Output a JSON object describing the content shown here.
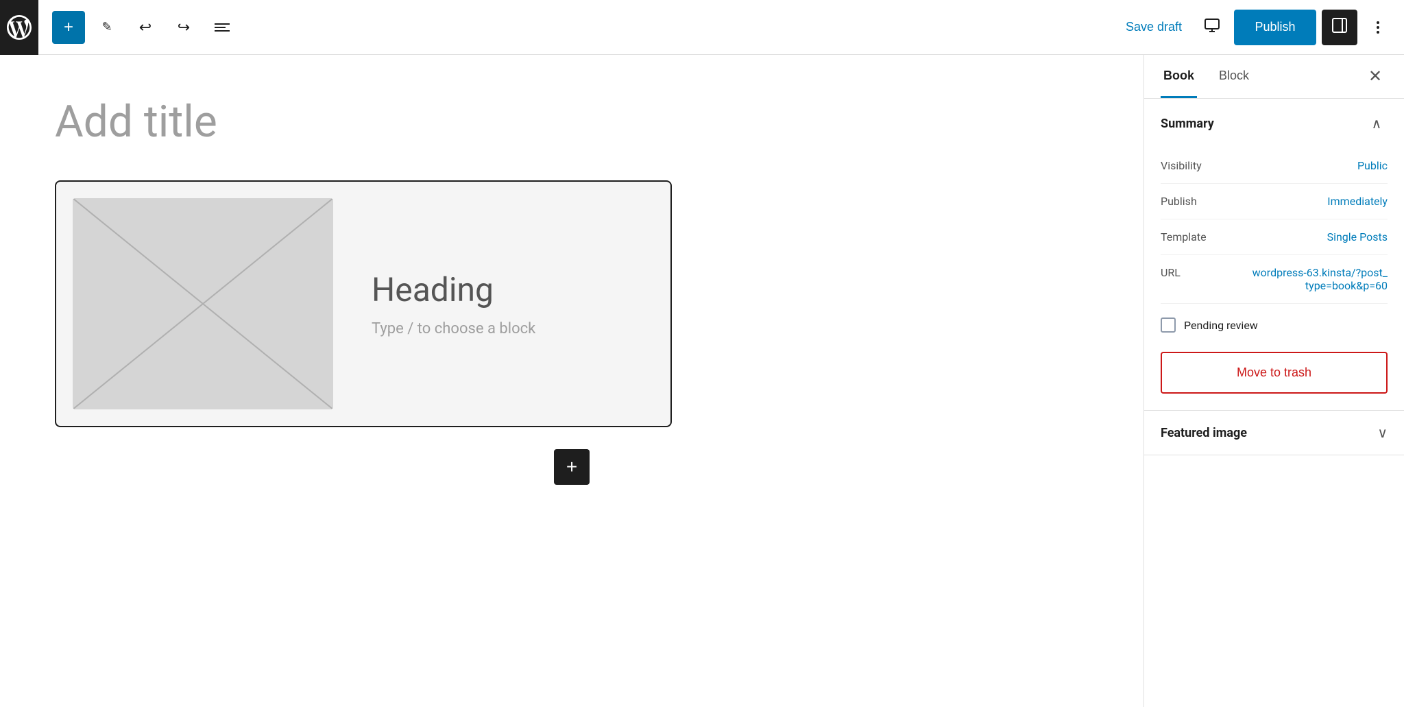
{
  "toolbar": {
    "add_label": "+",
    "edit_icon": "edit-icon",
    "undo_icon": "undo-icon",
    "redo_icon": "redo-icon",
    "list_icon": "list-icon",
    "save_draft_label": "Save draft",
    "preview_icon": "preview-icon",
    "publish_label": "Publish",
    "sidebar_toggle_icon": "sidebar-toggle-icon",
    "more_icon": "more-icon"
  },
  "editor": {
    "title_placeholder": "Add title",
    "block": {
      "heading": "Heading",
      "placeholder": "Type / to choose a block"
    },
    "add_block_label": "+"
  },
  "sidebar": {
    "tabs": [
      {
        "label": "Book",
        "active": true
      },
      {
        "label": "Block",
        "active": false
      }
    ],
    "close_label": "✕",
    "summary": {
      "title": "Summary",
      "visibility_label": "Visibility",
      "visibility_value": "Public",
      "publish_label": "Publish",
      "publish_value": "Immediately",
      "template_label": "Template",
      "template_value": "Single Posts",
      "url_label": "URL",
      "url_value": "wordpress-63.kinsta/?post_type=book&p=60",
      "pending_review_label": "Pending review",
      "move_to_trash_label": "Move to trash"
    },
    "featured_image": {
      "title": "Featured image"
    }
  }
}
